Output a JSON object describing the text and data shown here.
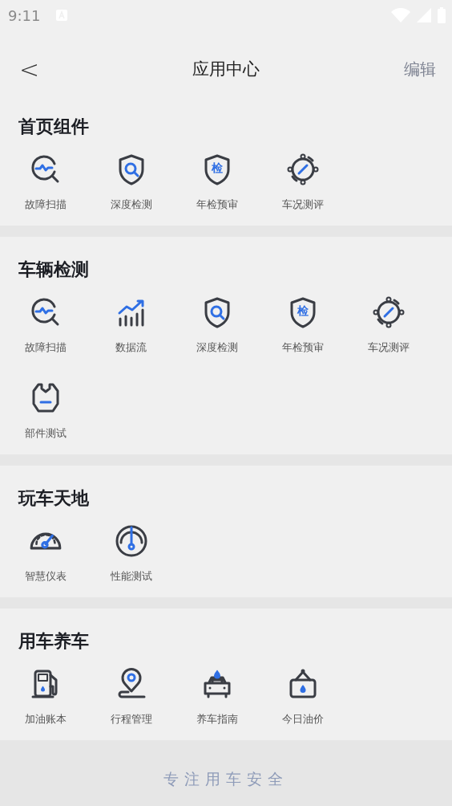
{
  "status_bar": {
    "time": "9:11"
  },
  "header": {
    "back": "<",
    "title": "应用中心",
    "action": "编辑"
  },
  "sections": [
    {
      "title": "首页组件",
      "items": [
        {
          "kind": "scan",
          "label": "故障扫描"
        },
        {
          "kind": "shield_search",
          "label": "深度检测"
        },
        {
          "kind": "shield_badge",
          "badge": "检",
          "label": "年检预审"
        },
        {
          "kind": "gauge_ring",
          "label": "车况测评"
        }
      ]
    },
    {
      "title": "车辆检测",
      "items": [
        {
          "kind": "scan",
          "label": "故障扫描"
        },
        {
          "kind": "chart",
          "label": "数据流"
        },
        {
          "kind": "shield_search",
          "label": "深度检测"
        },
        {
          "kind": "shield_badge",
          "badge": "检",
          "label": "年检预审"
        },
        {
          "kind": "gauge_ring",
          "label": "车况测评"
        },
        {
          "kind": "wrench",
          "label": "部件测试"
        }
      ]
    },
    {
      "title": "玩车天地",
      "items": [
        {
          "kind": "speedometer",
          "label": "智慧仪表"
        },
        {
          "kind": "dial",
          "label": "性能测试"
        }
      ]
    },
    {
      "title": "用车养车",
      "items": [
        {
          "kind": "fuel_pump",
          "label": "加油账本"
        },
        {
          "kind": "route_pin",
          "label": "行程管理"
        },
        {
          "kind": "car_drop",
          "label": "养车指南"
        },
        {
          "kind": "sign_drop",
          "label": "今日油价"
        }
      ]
    }
  ],
  "footer": {
    "slogan": "专注用车安全"
  }
}
